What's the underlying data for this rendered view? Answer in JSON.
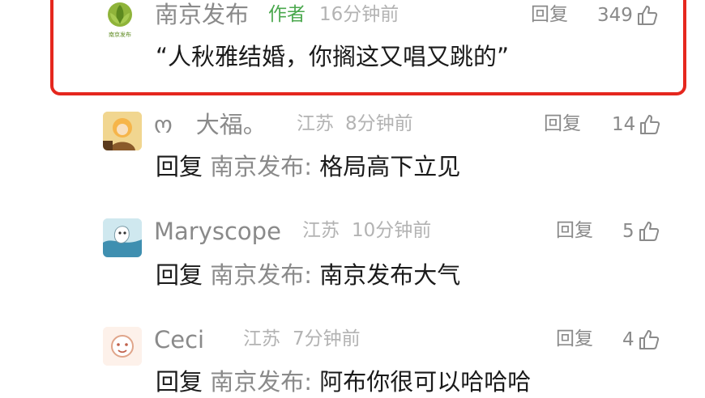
{
  "comments": [
    {
      "username": "南京发布",
      "author_tag": "作者",
      "location": "",
      "time": "16分钟前",
      "reply_label": "回复",
      "likes": "349",
      "avatar_text": "南京发布",
      "text": "“人秋雅结婚，你搁这又唱又跳的”"
    },
    {
      "username": "ო　大福。",
      "location": "江苏",
      "time": "8分钟前",
      "reply_label": "回复",
      "likes": "14",
      "reply_prefix": "回复",
      "reply_target": "南京发布:",
      "text": "格局高下立见"
    },
    {
      "username": "Maryscope",
      "location": "江苏",
      "time": "10分钟前",
      "reply_label": "回复",
      "likes": "5",
      "reply_prefix": "回复",
      "reply_target": "南京发布:",
      "text": "南京发布大气"
    },
    {
      "username": "Ceci",
      "location": "江苏",
      "time": "7分钟前",
      "reply_label": "回复",
      "likes": "4",
      "reply_prefix": "回复",
      "reply_target": "南京发布:",
      "text": "阿布你很可以哈哈哈"
    }
  ],
  "colors": {
    "highlight_border": "#e5271e",
    "author_tag": "#4ba84e",
    "secondary_text": "#8a8a8a",
    "meta_text": "#b3b3b3"
  }
}
